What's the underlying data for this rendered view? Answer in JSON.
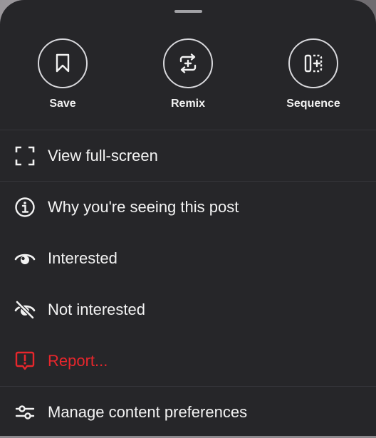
{
  "sheet": {
    "actions": [
      {
        "label": "Save",
        "icon": "bookmark-icon"
      },
      {
        "label": "Remix",
        "icon": "remix-icon"
      },
      {
        "label": "Sequence",
        "icon": "sequence-icon"
      }
    ],
    "menu": [
      {
        "label": "View full-screen",
        "icon": "fullscreen-icon"
      },
      {
        "label": "Why you're seeing this post",
        "icon": "info-icon"
      },
      {
        "label": "Interested",
        "icon": "eye-icon"
      },
      {
        "label": "Not interested",
        "icon": "eye-off-icon"
      },
      {
        "label": "Report...",
        "icon": "report-icon",
        "color": "#e8262c"
      },
      {
        "label": "Manage content preferences",
        "icon": "sliders-icon"
      }
    ]
  },
  "colors": {
    "sheet_background": "#262629",
    "text": "#f3f3f3",
    "danger": "#e8262c"
  }
}
